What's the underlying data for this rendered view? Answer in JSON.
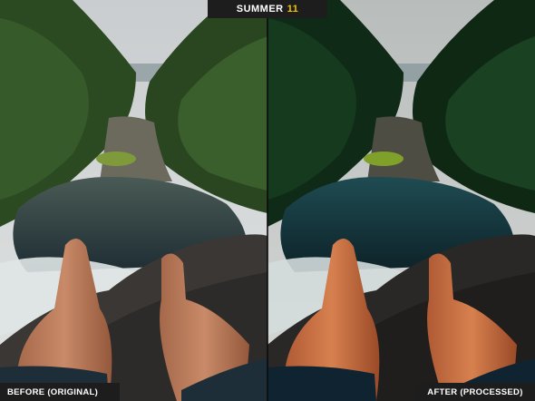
{
  "title": {
    "main": "SUMMER",
    "accent": "11",
    "accent_color": "#f2c200"
  },
  "labels": {
    "before": "BEFORE (ORIGINAL)",
    "after": "AFTER (PROCESSED)"
  },
  "colors": {
    "tag_background": "#1d1d1d",
    "tag_text": "#ffffff"
  }
}
